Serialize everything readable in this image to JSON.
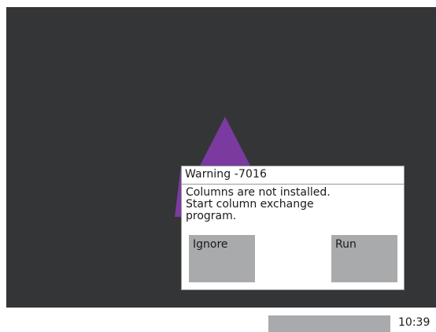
{
  "colors": {
    "screen_background": "#343536",
    "logo_accent": "#7a3aa0",
    "button_gray": "#a9aaac",
    "dialog_background": "#ffffff"
  },
  "dialog": {
    "title": "Warning -7016",
    "message_lines": [
      "Columns are not installed.",
      "Start column exchange",
      "program."
    ],
    "buttons": {
      "ignore_label": "Ignore",
      "run_label": "Run"
    }
  },
  "statusbar": {
    "time": "10:39"
  },
  "background_graphic": {
    "icon": "purple-triangle-logo"
  }
}
